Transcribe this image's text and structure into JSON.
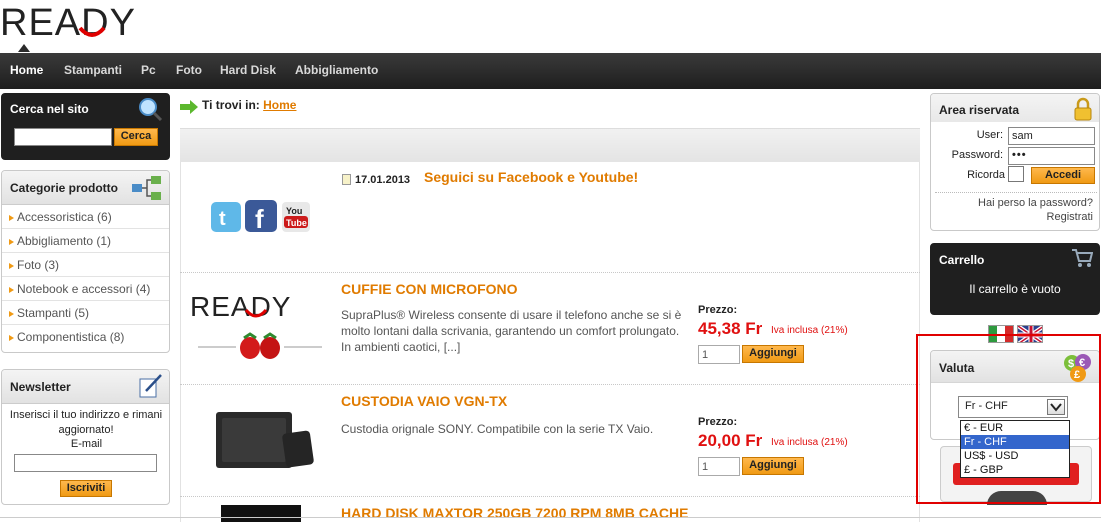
{
  "logo": {
    "text": "READY"
  },
  "nav": [
    "Home",
    "Stampanti",
    "Pc",
    "Foto",
    "Hard Disk",
    "Abbigliamento"
  ],
  "search": {
    "title": "Cerca nel sito",
    "button": "Cerca",
    "value": ""
  },
  "categories": {
    "title": "Categorie prodotto",
    "items": [
      "Accessoristica (6)",
      "Abbigliamento (1)",
      "Foto (3)",
      "Notebook e accessori (4)",
      "Stampanti (5)",
      "Componentistica (8)"
    ]
  },
  "newsletter": {
    "title": "Newsletter",
    "text": "Inserisci il tuo indirizzo e rimani aggiornato!",
    "email_label": "E-mail",
    "button": "Iscriviti"
  },
  "breadcrumb": {
    "prefix": "Ti trovi in:",
    "current": "Home"
  },
  "news": {
    "date": "17.01.2013",
    "title": "Seguici su Facebook e Youtube!"
  },
  "products": [
    {
      "title": "CUFFIE CON MICROFONO",
      "desc": "SupraPlus® Wireless consente di usare il telefono anche se si è molto lontani dalla scrivania, garantendo un comfort prolungato. In ambienti caotici, [...]",
      "price_label": "Prezzo:",
      "price": "45,38 Fr",
      "vat": "Iva inclusa (21%)",
      "qty": "1",
      "button": "Aggiungi"
    },
    {
      "title": "CUSTODIA VAIO VGN-TX",
      "desc": "Custodia orignale SONY. Compatibile con la serie TX Vaio.",
      "price_label": "Prezzo:",
      "price": "20,00 Fr",
      "vat": "Iva inclusa (21%)",
      "qty": "1",
      "button": "Aggiungi"
    },
    {
      "title": "HARD DISK MAXTOR 250GB 7200 RPM 8MB CACHE"
    }
  ],
  "login": {
    "title": "Area riservata",
    "user_label": "User:",
    "user_value": "sam",
    "password_label": "Password:",
    "password_value": "•••",
    "remember_label": "Ricorda",
    "button": "Accedi",
    "forgot": "Hai perso la password?",
    "register": "Registrati"
  },
  "cart": {
    "title": "Carrello",
    "empty": "Il carrello è vuoto"
  },
  "currency": {
    "title": "Valuta",
    "selected": "Fr - CHF",
    "options": [
      "€ - EUR",
      "Fr - CHF",
      "US$ - USD",
      "£ - GBP"
    ],
    "selected_index": 1
  },
  "colors": {
    "accent": "#f09a14",
    "link": "#e07b00",
    "price": "#e01010",
    "nav_bg": "#2a2a2a"
  }
}
